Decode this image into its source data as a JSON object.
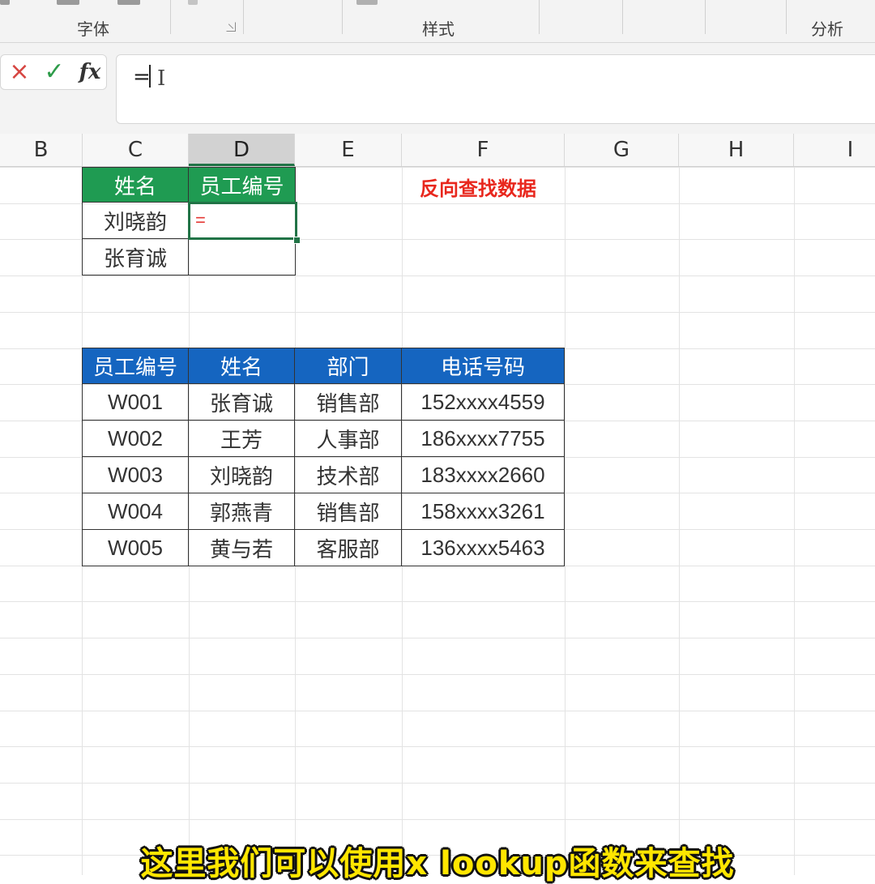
{
  "ribbon": {
    "groups": [
      "字体",
      "样式",
      "分析"
    ]
  },
  "formula_bar": {
    "cancel_icon": "×",
    "enter_icon": "✓",
    "function_icon": "fx",
    "value": "="
  },
  "columns": [
    "B",
    "C",
    "D",
    "E",
    "F",
    "G",
    "H",
    "I"
  ],
  "active_column": "D",
  "lookup_table": {
    "headers": [
      "姓名",
      "员工编号"
    ],
    "rows": [
      [
        "刘晓韵",
        "="
      ],
      [
        "张育诚",
        ""
      ]
    ],
    "header_color": "#1f9b52"
  },
  "note": {
    "text": "反向查找数据",
    "color": "#e8271d"
  },
  "source_table": {
    "headers": [
      "员工编号",
      "姓名",
      "部门",
      "电话号码"
    ],
    "rows": [
      [
        "W001",
        "张育诚",
        "销售部",
        "152xxxx4559"
      ],
      [
        "W002",
        "王芳",
        "人事部",
        "186xxxx7755"
      ],
      [
        "W003",
        "刘晓韵",
        "技术部",
        "183xxxx2660"
      ],
      [
        "W004",
        "郭燕青",
        "销售部",
        "158xxxx3261"
      ],
      [
        "W005",
        "黄与若",
        "客服部",
        "136xxxx5463"
      ]
    ],
    "header_color": "#1565c0"
  },
  "subtitle": "这里我们可以使用x lookup函数来查找",
  "accent_color": "#217346"
}
